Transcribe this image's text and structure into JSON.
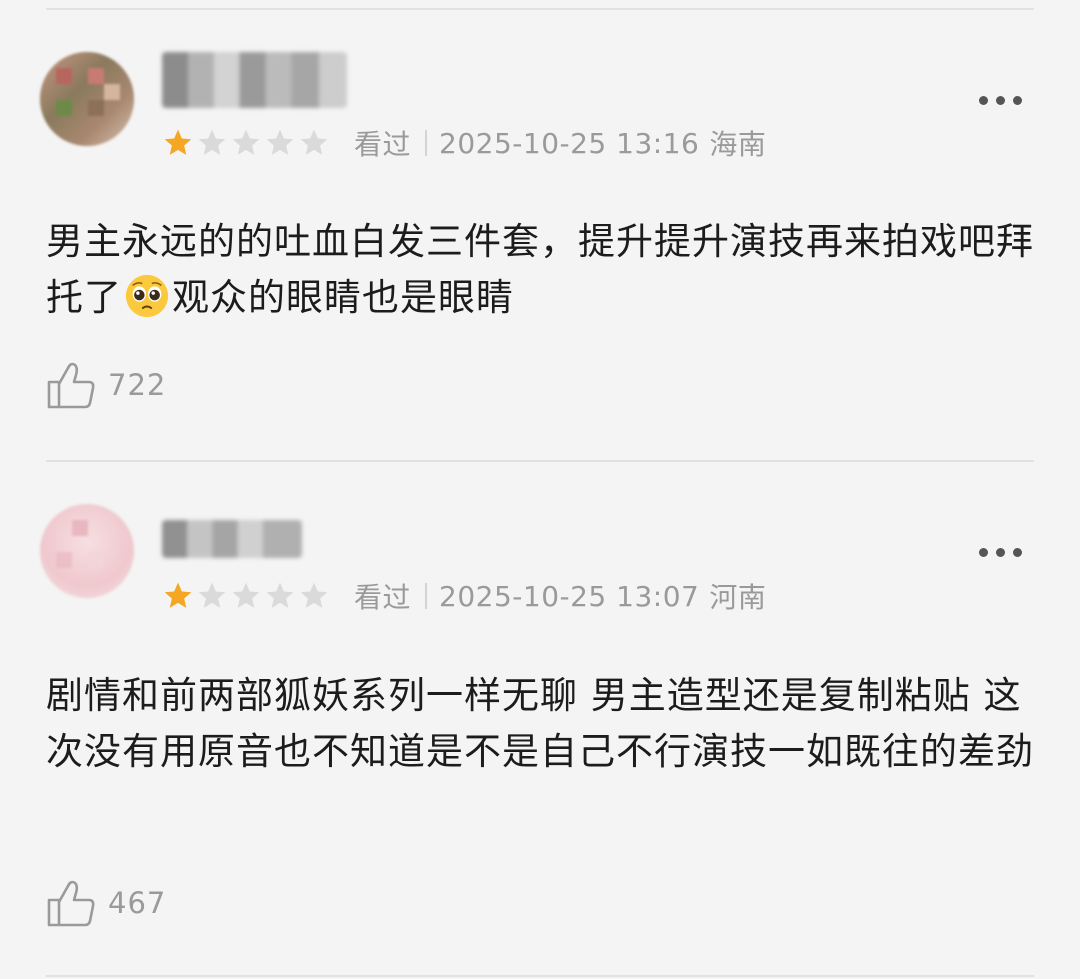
{
  "colors": {
    "star_filled": "#f5a623",
    "star_empty": "#d9d9d9",
    "meta_text": "#9a9a9a"
  },
  "reviews": [
    {
      "rating_stars": 1,
      "watched_label": "看过",
      "datetime": "2025-10-25 13:16",
      "location": "海南",
      "content_before_emoji": "男主永远的的吐血白发三件套，提升提升演技再来拍戏吧拜托了",
      "emoji_icon": "pleading-face-emoji",
      "content_after_emoji": "观众的眼睛也是眼睛",
      "likes": "722"
    },
    {
      "rating_stars": 1,
      "watched_label": "看过",
      "datetime": "2025-10-25 13:07",
      "location": "河南",
      "content": "剧情和前两部狐妖系列一样无聊 男主造型还是复制粘贴 这次没有用原音也不知道是不是自己不行演技一如既往的差劲",
      "likes": "467"
    }
  ]
}
